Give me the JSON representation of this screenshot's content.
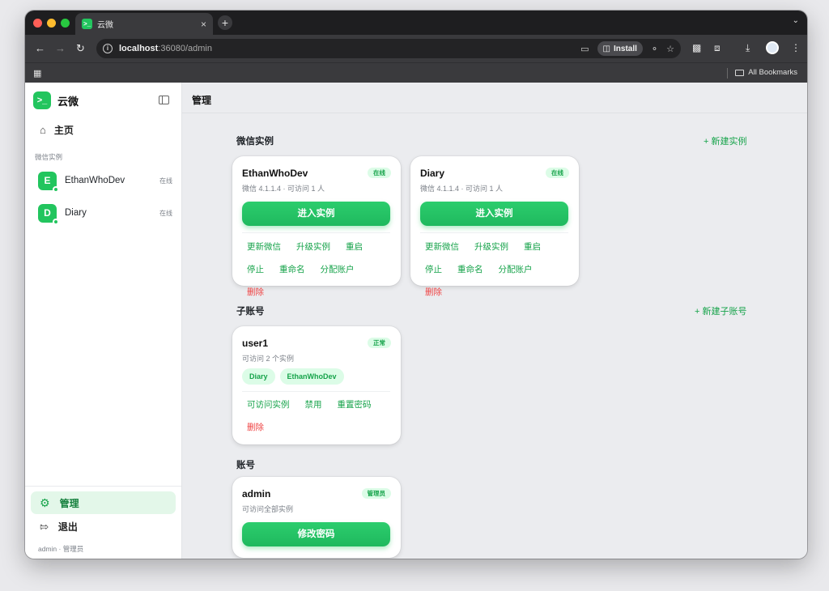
{
  "browser": {
    "tab_favicon": ">_",
    "tab_title": "云微",
    "tab_close": "×",
    "new_tab": "+",
    "url_host": "localhost",
    "url_rest": ":36080/admin",
    "install_label": "Install",
    "bookmarks_label": "All Bookmarks"
  },
  "sidebar": {
    "logo": ">_",
    "brand": "云微",
    "home_label": "主页",
    "section_label": "微信实例",
    "instances": [
      {
        "avatar": "E",
        "name": "EthanWhoDev",
        "status": "在线"
      },
      {
        "avatar": "D",
        "name": "Diary",
        "status": "在线"
      }
    ],
    "admin_label": "管理",
    "logout_label": "退出",
    "user_caption": "admin · 管理员"
  },
  "main": {
    "title": "管理",
    "instances_section": {
      "title": "微信实例",
      "action": "+ 新建实例",
      "cards": [
        {
          "name": "EthanWhoDev",
          "badge": "在线",
          "sub": "微信 4.1.1.4 · 可访问 1 人",
          "primary": "进入实例",
          "actions": [
            "更新微信",
            "升级实例",
            "重启",
            "停止",
            "重命名",
            "分配账户",
            "删除"
          ]
        },
        {
          "name": "Diary",
          "badge": "在线",
          "sub": "微信 4.1.1.4 · 可访问 1 人",
          "primary": "进入实例",
          "actions": [
            "更新微信",
            "升级实例",
            "重启",
            "停止",
            "重命名",
            "分配账户",
            "删除"
          ]
        }
      ]
    },
    "subaccounts_section": {
      "title": "子账号",
      "action": "+ 新建子账号",
      "card": {
        "name": "user1",
        "badge": "正常",
        "sub": "可访问 2 个实例",
        "chips": [
          "Diary",
          "EthanWhoDev"
        ],
        "actions": [
          "可访问实例",
          "禁用",
          "重置密码",
          "删除"
        ]
      }
    },
    "accounts_section": {
      "title": "账号",
      "card": {
        "name": "admin",
        "badge": "管理员",
        "sub": "可访问全部实例",
        "primary": "修改密码"
      }
    }
  },
  "colors": {
    "accent": "#22c55e",
    "accent_dark": "#16a34a",
    "danger": "#ef4444"
  }
}
